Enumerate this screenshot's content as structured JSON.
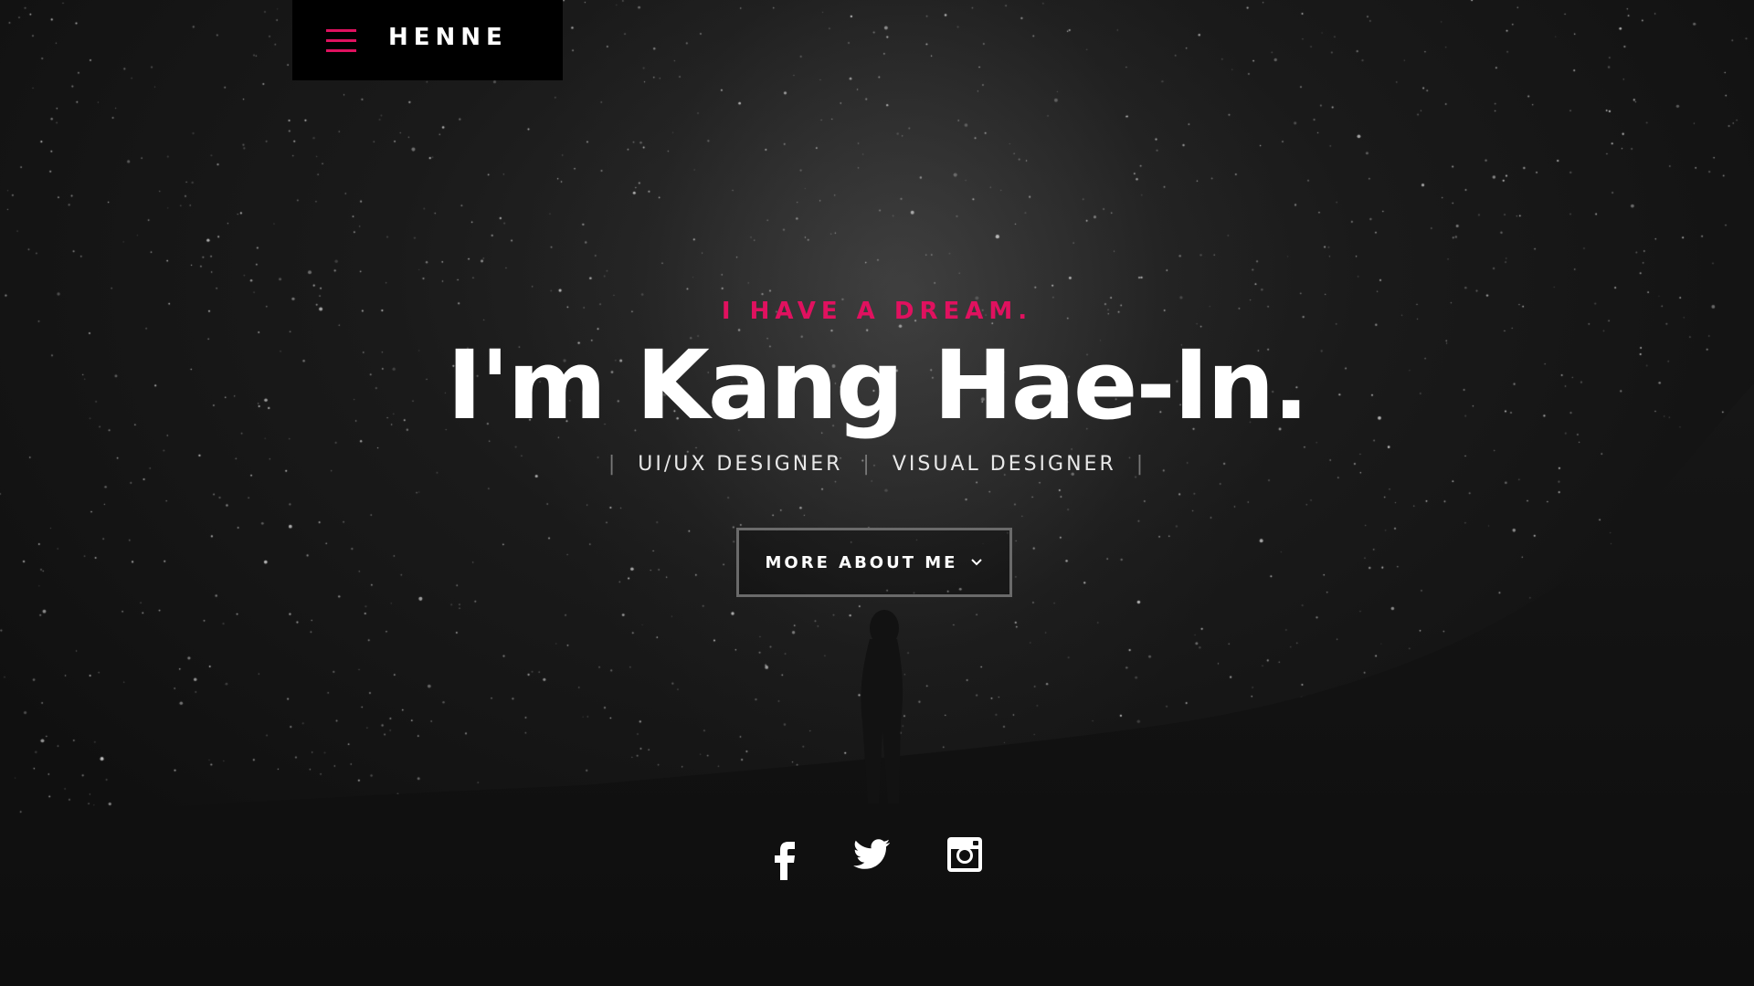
{
  "brand": {
    "name": "HENNE",
    "menu_icon": "hamburger-menu-icon",
    "accent_color": "#e0115f"
  },
  "hero": {
    "tagline": "I HAVE A DREAM.",
    "headline": "I'm Kang Hae-In.",
    "roles": [
      "UI/UX DESIGNER",
      "VISUAL DESIGNER"
    ],
    "separator": "|",
    "button_label": "MORE ABOUT ME",
    "button_icon": "chevron-down-icon"
  },
  "social": [
    {
      "name": "facebook-icon"
    },
    {
      "name": "twitter-icon"
    },
    {
      "name": "instagram-icon"
    }
  ]
}
